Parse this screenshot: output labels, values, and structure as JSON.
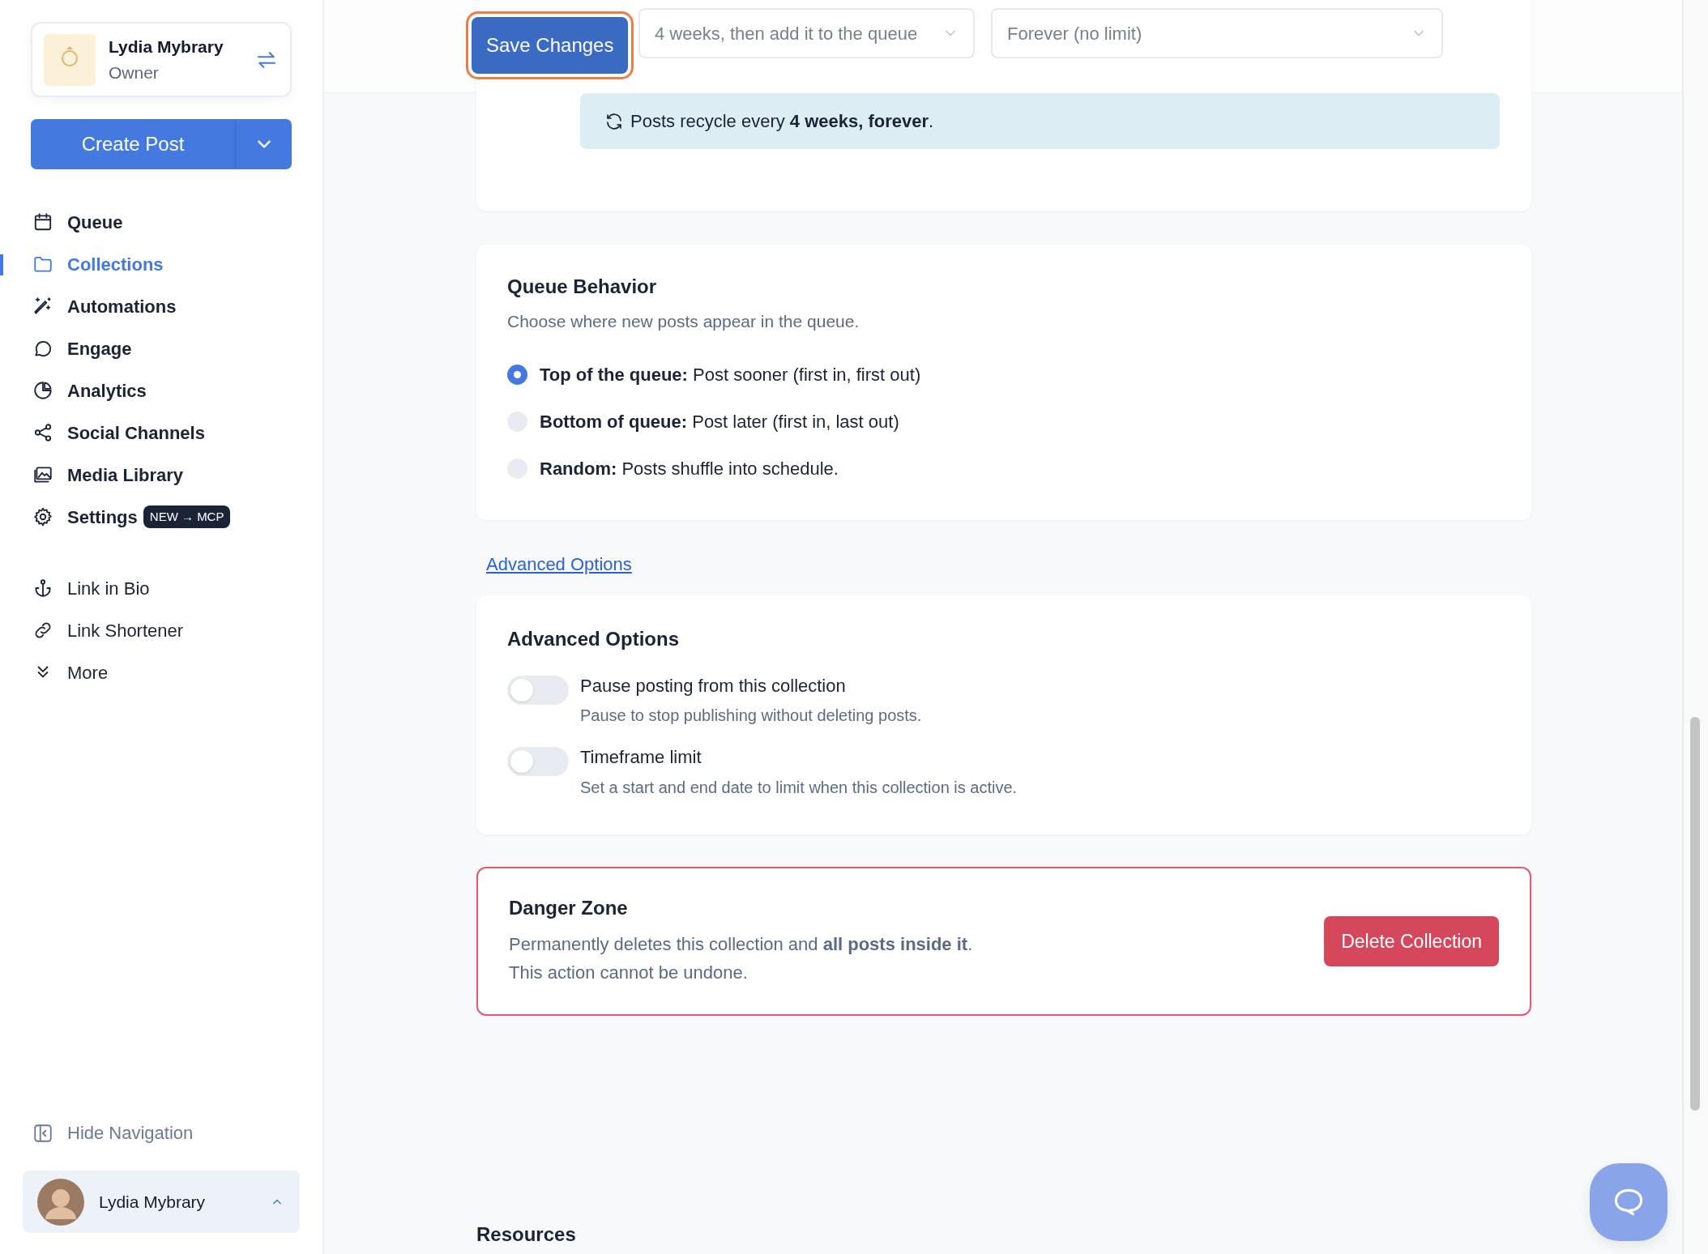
{
  "account": {
    "name": "Lydia Mybrary",
    "role": "Owner"
  },
  "create_button": {
    "label": "Create Post"
  },
  "nav_main": [
    {
      "label": "Queue",
      "selected": false
    },
    {
      "label": "Collections",
      "selected": true
    },
    {
      "label": "Automations",
      "selected": false
    },
    {
      "label": "Engage",
      "selected": false
    },
    {
      "label": "Analytics",
      "selected": false
    },
    {
      "label": "Social Channels",
      "selected": false
    },
    {
      "label": "Media Library",
      "selected": false
    },
    {
      "label": "Settings",
      "selected": false,
      "badge": "NEW → MCP"
    }
  ],
  "nav_secondary": [
    {
      "label": "Link in Bio"
    },
    {
      "label": "Link Shortener"
    },
    {
      "label": "More"
    }
  ],
  "hide_navigation": "Hide Navigation",
  "user": {
    "name": "Lydia Mybrary"
  },
  "save_button": "Save Changes",
  "recycle": {
    "selects": [
      {
        "value": "4 weeks, then add it to the queue"
      },
      {
        "value": "Forever (no limit)"
      }
    ],
    "notice": "Posts recycle every **4 weeks, forever**."
  },
  "queue_behavior": {
    "title": "Queue Behavior",
    "subtitle": "Choose where new posts appear in the queue.",
    "options": [
      {
        "label": "**Top of the queue:** Post sooner (first in, first out)",
        "selected": true
      },
      {
        "label": "**Bottom of queue:** Post later (first in, last out)",
        "selected": false
      },
      {
        "label": "**Random:** Posts shuffle into schedule.",
        "selected": false
      }
    ]
  },
  "advanced_link": "Advanced Options",
  "advanced": {
    "title": "Advanced Options",
    "toggles": [
      {
        "label": "Pause posting from this collection",
        "description": "Pause to stop publishing without deleting posts.",
        "on": false
      },
      {
        "label": "Timeframe limit",
        "description": "Set a start and end date to limit when this collection is active.",
        "on": false
      }
    ]
  },
  "danger": {
    "title": "Danger Zone",
    "lines": [
      "Permanently deletes this collection and **all posts inside it**.",
      "This action cannot be undone."
    ],
    "button": "Delete Collection"
  },
  "resources_title": "Resources"
}
